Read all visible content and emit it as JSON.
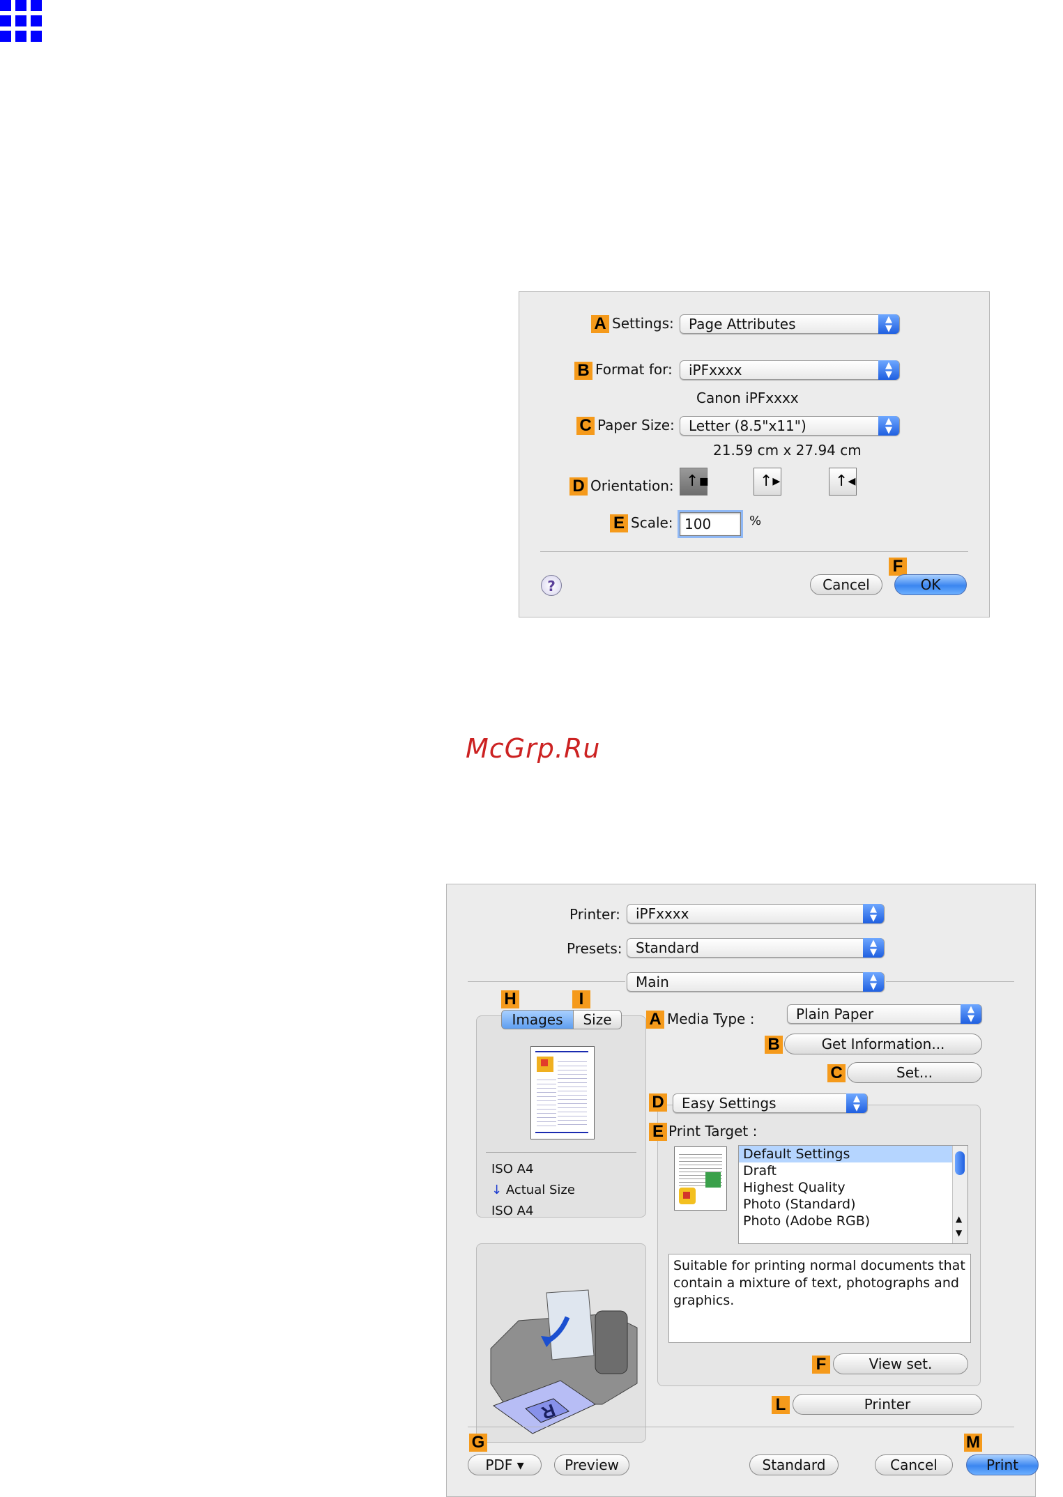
{
  "page_setup": {
    "settings_label": "Settings:",
    "settings_value": "Page Attributes",
    "format_for_label": "Format for:",
    "format_for_value": "iPFxxxx",
    "format_for_subtext": "Canon iPFxxxx",
    "paper_size_label": "Paper Size:",
    "paper_size_value": "Letter (8.5\"x11\")",
    "paper_size_subtext": "21.59 cm x 27.94 cm",
    "orientation_label": "Orientation:",
    "scale_label": "Scale:",
    "scale_value": "100",
    "scale_unit": "%",
    "help_label": "?",
    "cancel_label": "Cancel",
    "ok_label": "OK",
    "badges": {
      "a": "A",
      "b": "B",
      "c": "C",
      "d": "D",
      "e": "E",
      "f": "F"
    }
  },
  "watermark": "McGrp.Ru",
  "print_dialog": {
    "printer_label": "Printer:",
    "printer_value": "iPFxxxx",
    "presets_label": "Presets:",
    "presets_value": "Standard",
    "panel_value": "Main",
    "tab_images": "Images",
    "tab_size": "Size",
    "media_type_label": "Media Type :",
    "media_type_value": "Plain Paper",
    "get_info_label": "Get Information...",
    "set_label": "Set...",
    "easy_settings_value": "Easy Settings",
    "print_target_label": "Print Target :",
    "print_targets": [
      "Default Settings",
      "Draft",
      "Highest Quality",
      "Photo (Standard)",
      "Photo (Adobe RGB)"
    ],
    "description": "Suitable for printing normal documents that contain a mixture of text, photographs and graphics.",
    "view_set_label": "View set.",
    "printer_button_label": "Printer",
    "size_info": {
      "line1": "ISO A4",
      "line2": "Actual Size",
      "line3": "ISO A4"
    },
    "pdf_label": "PDF ▾",
    "preview_label": "Preview",
    "standard_label": "Standard",
    "cancel_label": "Cancel",
    "print_label": "Print",
    "badges": {
      "h": "H",
      "i": "I",
      "a": "A",
      "b": "B",
      "c": "C",
      "d": "D",
      "e": "E",
      "f": "F",
      "l": "L",
      "g": "G",
      "m": "M"
    }
  }
}
